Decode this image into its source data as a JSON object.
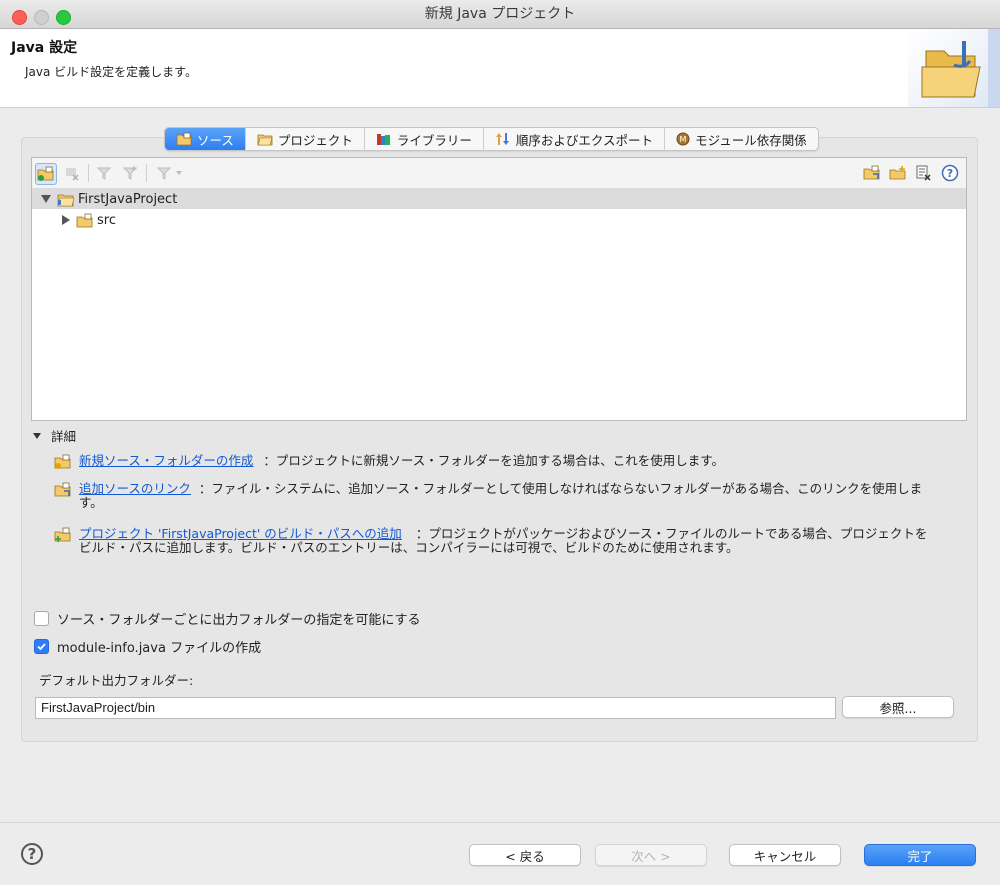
{
  "window": {
    "title": "新規 Java プロジェクト"
  },
  "header": {
    "title": "Java 設定",
    "description": "Java ビルド設定を定義します。"
  },
  "tabs": [
    {
      "label": "ソース",
      "active": true
    },
    {
      "label": "プロジェクト",
      "active": false
    },
    {
      "label": "ライブラリー",
      "active": false
    },
    {
      "label": "順序およびエクスポート",
      "active": false
    },
    {
      "label": "モジュール依存関係",
      "active": false
    }
  ],
  "tree": {
    "project": "FirstJavaProject",
    "child": "src"
  },
  "details": {
    "heading": "詳細",
    "items": [
      {
        "link": "新規ソース・フォルダーの作成",
        "text": "：プロジェクトに新規ソース・フォルダーを追加する場合は、これを使用します。"
      },
      {
        "link": "追加ソースのリンク",
        "text": "：ファイル・システムに、追加ソース・フォルダーとして使用しなければならないフォルダーがある場合、このリンクを使用しま",
        "text2": "す。"
      },
      {
        "link": "プロジェクト 'FirstJavaProject' のビルド・パスへの追加",
        "text": "：プロジェクトがパッケージおよびソース・ファイルのルートである場合、プロジェクトを",
        "text2": "ビルド・パスに追加します。ビルド・パスのエントリーは、コンパイラーには可視で、ビルドのために使用されます。"
      }
    ]
  },
  "options": {
    "per_folder_output": {
      "label": "ソース・フォルダーごとに出力フォルダーの指定を可能にする",
      "checked": false
    },
    "module_info": {
      "label": "module-info.java ファイルの作成",
      "checked": true
    }
  },
  "output": {
    "label": "デフォルト出力フォルダー:",
    "value": "FirstJavaProject/bin",
    "browse": "参照..."
  },
  "buttons": {
    "back": "< 戻る",
    "next": "次へ >",
    "cancel": "キャンセル",
    "finish": "完了"
  },
  "help_glyph": "?",
  "colors": {
    "accent": "#2b7ff2",
    "link": "#1159d6"
  }
}
